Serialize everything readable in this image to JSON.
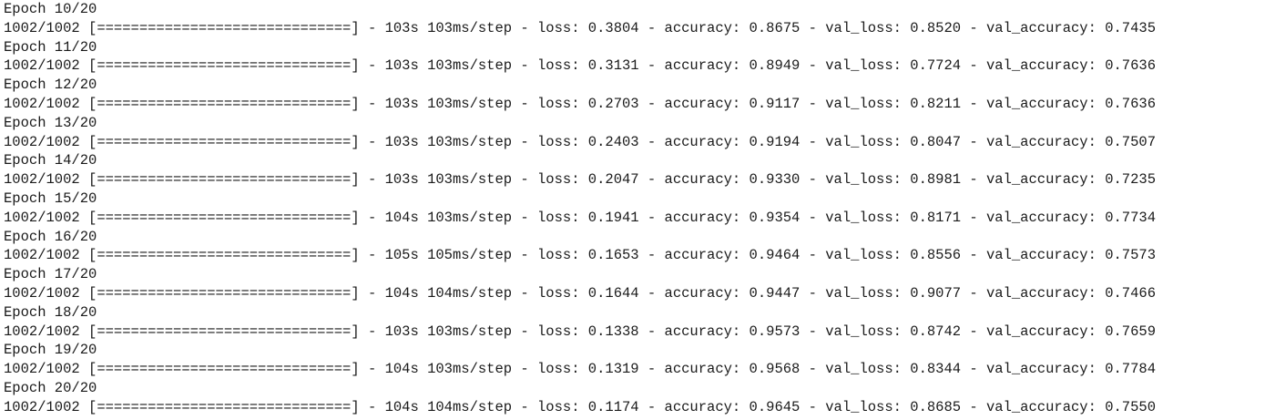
{
  "log": {
    "lines": [
      "Epoch 10/20",
      "1002/1002 [==============================] - 103s 103ms/step - loss: 0.3804 - accuracy: 0.8675 - val_loss: 0.8520 - val_accuracy: 0.7435",
      "Epoch 11/20",
      "1002/1002 [==============================] - 103s 103ms/step - loss: 0.3131 - accuracy: 0.8949 - val_loss: 0.7724 - val_accuracy: 0.7636",
      "Epoch 12/20",
      "1002/1002 [==============================] - 103s 103ms/step - loss: 0.2703 - accuracy: 0.9117 - val_loss: 0.8211 - val_accuracy: 0.7636",
      "Epoch 13/20",
      "1002/1002 [==============================] - 103s 103ms/step - loss: 0.2403 - accuracy: 0.9194 - val_loss: 0.8047 - val_accuracy: 0.7507",
      "Epoch 14/20",
      "1002/1002 [==============================] - 103s 103ms/step - loss: 0.2047 - accuracy: 0.9330 - val_loss: 0.8981 - val_accuracy: 0.7235",
      "Epoch 15/20",
      "1002/1002 [==============================] - 104s 103ms/step - loss: 0.1941 - accuracy: 0.9354 - val_loss: 0.8171 - val_accuracy: 0.7734",
      "Epoch 16/20",
      "1002/1002 [==============================] - 105s 105ms/step - loss: 0.1653 - accuracy: 0.9464 - val_loss: 0.8556 - val_accuracy: 0.7573",
      "Epoch 17/20",
      "1002/1002 [==============================] - 104s 104ms/step - loss: 0.1644 - accuracy: 0.9447 - val_loss: 0.9077 - val_accuracy: 0.7466",
      "Epoch 18/20",
      "1002/1002 [==============================] - 103s 103ms/step - loss: 0.1338 - accuracy: 0.9573 - val_loss: 0.8742 - val_accuracy: 0.7659",
      "Epoch 19/20",
      "1002/1002 [==============================] - 104s 103ms/step - loss: 0.1319 - accuracy: 0.9568 - val_loss: 0.8344 - val_accuracy: 0.7784",
      "Epoch 20/20",
      "1002/1002 [==============================] - 104s 104ms/step - loss: 0.1174 - accuracy: 0.9645 - val_loss: 0.8685 - val_accuracy: 0.7550"
    ]
  }
}
